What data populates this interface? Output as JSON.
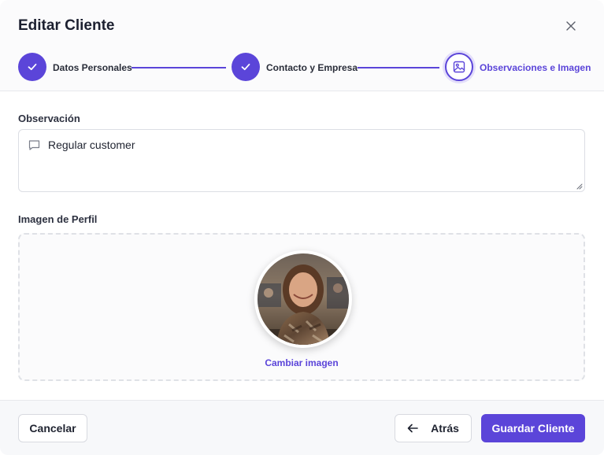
{
  "dialog": {
    "title": "Editar Cliente",
    "close_icon": "close-icon"
  },
  "stepper": {
    "steps": [
      {
        "label": "Datos Personales",
        "status": "completed",
        "icon": "check-icon"
      },
      {
        "label": "Contacto y Empresa",
        "status": "completed",
        "icon": "check-icon"
      },
      {
        "label": "Observaciones e Imagen",
        "status": "active",
        "icon": "image-icon"
      }
    ]
  },
  "observation": {
    "label": "Observación",
    "value": "Regular customer",
    "icon": "comment-icon"
  },
  "profile_image": {
    "label": "Imagen de Perfil",
    "change_label": "Cambiar imagen"
  },
  "footer": {
    "cancel_label": "Cancelar",
    "back_label": "Atrás",
    "back_icon": "arrow-left-icon",
    "save_label": "Guardar Cliente"
  },
  "colors": {
    "accent": "#5b45d9",
    "accent_soft": "#e3defa",
    "border": "#dcdee4"
  }
}
